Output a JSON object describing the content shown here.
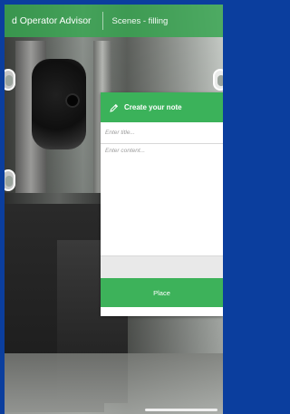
{
  "header": {
    "title": "d Operator Advisor",
    "scene": "Scenes - filling"
  },
  "note": {
    "heading": "Create your note",
    "title_placeholder": "Enter title...",
    "content_placeholder": "Enter content...",
    "place_label": "Place"
  },
  "icons": {
    "pencil": "pencil-icon"
  },
  "colors": {
    "frame": "#0b3e9e",
    "header_green": "#38a551",
    "panel_green": "#3bb25a"
  }
}
